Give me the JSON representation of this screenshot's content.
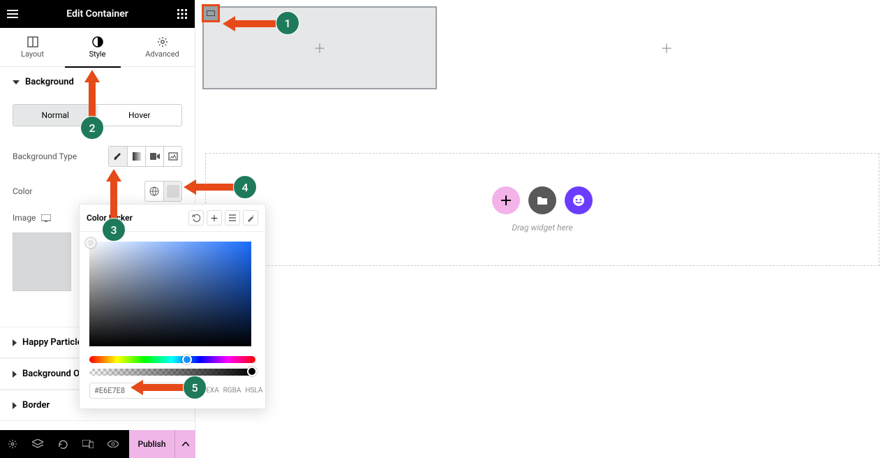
{
  "header": {
    "title": "Edit Container"
  },
  "tabs": {
    "layout": "Layout",
    "style": "Style",
    "advanced": "Advanced"
  },
  "section_background": "Background",
  "state": {
    "normal": "Normal",
    "hover": "Hover"
  },
  "bg_type_label": "Background Type",
  "color_label": "Color",
  "image_label": "Image",
  "sections": {
    "particles": "Happy Particles",
    "bgoverlay": "Background Overlay",
    "border": "Border"
  },
  "footer": {
    "publish": "Publish"
  },
  "picker": {
    "title": "Color Picker",
    "hex": "#E6E7E8",
    "modes": {
      "hexa": "HEXA",
      "rgba": "RGBA",
      "hsla": "HSLA"
    }
  },
  "canvas": {
    "drag_text": "Drag widget here"
  },
  "annotations": {
    "a1": "1",
    "a2": "2",
    "a3": "3",
    "a4": "4",
    "a5": "5"
  }
}
